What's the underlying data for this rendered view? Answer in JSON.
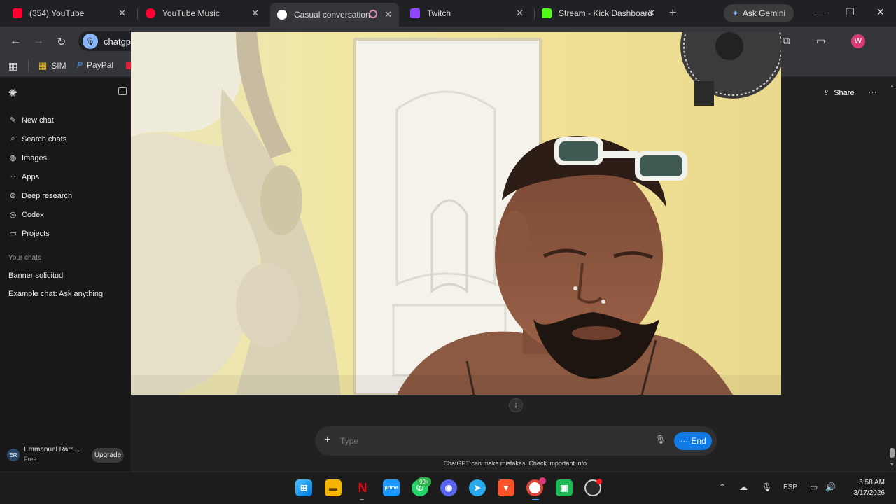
{
  "browser": {
    "tabs": [
      {
        "title": "(354) YouTube",
        "favicon_color": "#ff0033"
      },
      {
        "title": "YouTube Music",
        "favicon_color": "#ff0033"
      },
      {
        "title": "Casual conversation",
        "favicon_color": "#ffffff"
      },
      {
        "title": "Twitch",
        "favicon_color": "#9146ff"
      },
      {
        "title": "Stream - Kick Dashboard",
        "favicon_color": "#53fc18"
      }
    ],
    "ask_gemini": "Ask Gemini",
    "address": "chatgp",
    "bookmarks": [
      {
        "label": "SIM"
      },
      {
        "label": "PayPal"
      }
    ],
    "profile_initial": "W"
  },
  "sidebar": {
    "items": [
      {
        "label": "New chat",
        "icon": "edit-icon"
      },
      {
        "label": "Search chats",
        "icon": "search-icon"
      },
      {
        "label": "Images",
        "icon": "image-icon"
      },
      {
        "label": "Apps",
        "icon": "apps-icon"
      },
      {
        "label": "Deep research",
        "icon": "research-icon"
      },
      {
        "label": "Codex",
        "icon": "codex-icon"
      },
      {
        "label": "Projects",
        "icon": "folder-icon"
      }
    ],
    "section_title": "Your chats",
    "chats": [
      "Banner solicitud",
      "Example chat: Ask anything"
    ],
    "user": {
      "initials": "ER",
      "name": "Emmanuel Ram...",
      "plan": "Free"
    },
    "upgrade_label": "Upgrade"
  },
  "header": {
    "share_label": "Share"
  },
  "composer": {
    "placeholder": "Type",
    "end_label": "End",
    "disclaimer": "ChatGPT can make mistakes. Check important info."
  },
  "taskbar": {
    "whatsapp_badge": "99+",
    "language": "ESP",
    "time": "5:58 AM",
    "date": "3/17/2026"
  },
  "colors": {
    "accent": "#0f7ae5",
    "profile": "#d93b74"
  }
}
